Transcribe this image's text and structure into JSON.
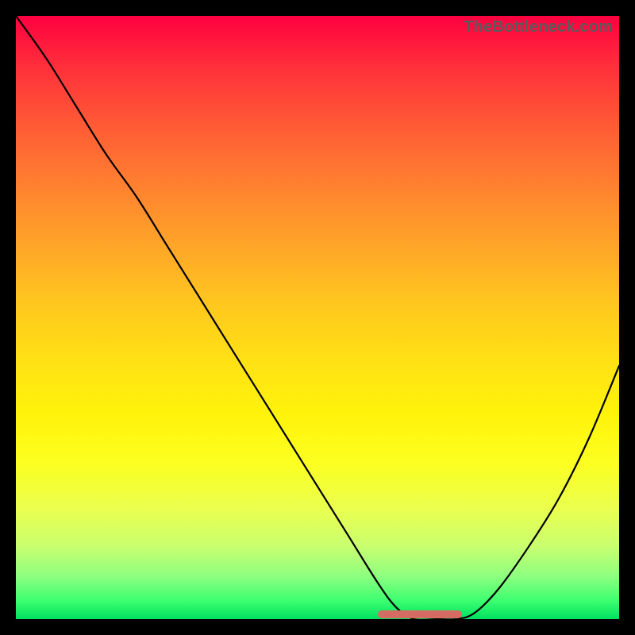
{
  "watermark": "TheBottleneck.com",
  "colors": {
    "frame": "#000000",
    "curve": "#000000",
    "highlight": "#d66b63",
    "gradient_top": "#ff0040",
    "gradient_bottom": "#00e060"
  },
  "chart_data": {
    "type": "line",
    "title": "",
    "xlabel": "",
    "ylabel": "",
    "xlim": [
      0,
      100
    ],
    "ylim": [
      0,
      100
    ],
    "grid": false,
    "legend": false,
    "x": [
      0,
      5,
      10,
      15,
      20,
      25,
      30,
      35,
      40,
      45,
      50,
      55,
      60,
      63,
      66,
      70,
      73,
      76,
      80,
      85,
      90,
      95,
      100
    ],
    "values": [
      100,
      93,
      85,
      77,
      70,
      62,
      54,
      46,
      38,
      30,
      22,
      14,
      6,
      2,
      0,
      0,
      0,
      1,
      5,
      12,
      20,
      30,
      42
    ],
    "highlight_band": {
      "x_start": 60,
      "x_end": 74,
      "y": 0.8
    },
    "annotations": []
  }
}
